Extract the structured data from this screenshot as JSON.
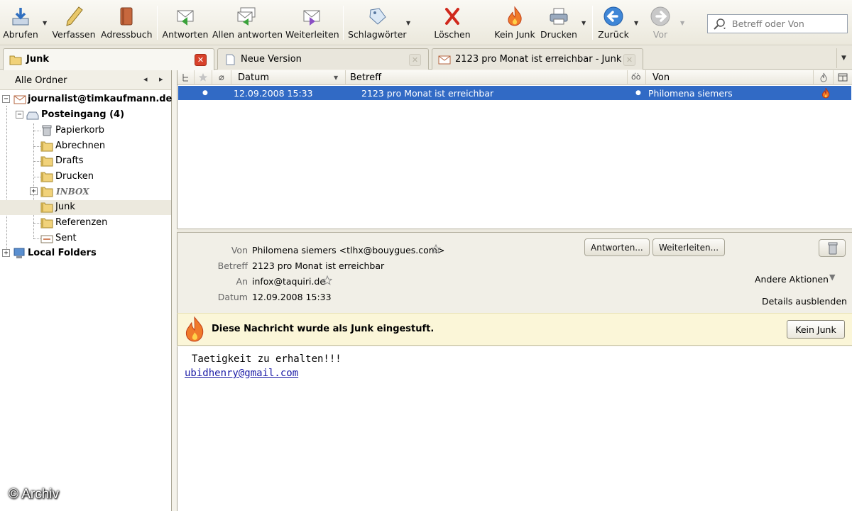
{
  "toolbar": {
    "buttons": [
      {
        "label": "Abrufen",
        "icon": "download-icon"
      },
      {
        "label": "Verfassen",
        "icon": "pencil-icon"
      },
      {
        "label": "Adressbuch",
        "icon": "addressbook-icon"
      },
      {
        "label": "Antworten",
        "icon": "reply-icon"
      },
      {
        "label": "Allen antworten",
        "icon": "reply-all-icon"
      },
      {
        "label": "Weiterleiten",
        "icon": "forward-icon"
      },
      {
        "label": "Schlagwörter",
        "icon": "tag-icon"
      },
      {
        "label": "Löschen",
        "icon": "delete-icon"
      },
      {
        "label": "Kein Junk",
        "icon": "flame-icon"
      },
      {
        "label": "Drucken",
        "icon": "printer-icon"
      },
      {
        "label": "Zurück",
        "icon": "back-arrow-icon"
      },
      {
        "label": "Vor",
        "icon": "forward-arrow-icon"
      }
    ],
    "search_placeholder": "Betreff oder Von"
  },
  "tabs": [
    {
      "label": "Junk",
      "icon": "folder-icon",
      "active": true
    },
    {
      "label": "Neue Version",
      "icon": "document-icon",
      "active": false
    },
    {
      "label": "2123 pro Monat ist erreichbar - Junk",
      "icon": "envelope-icon",
      "active": false
    }
  ],
  "folder_pane": {
    "header": "Alle Ordner",
    "account": "journalist@timkaufmann.de",
    "inbox": "Posteingang (4)",
    "folders": [
      "Papierkorb",
      "Abrechnen",
      "Drafts",
      "Drucken",
      "INBOX",
      "Junk",
      "Referenzen",
      "Sent"
    ],
    "selected": "Junk",
    "local": "Local Folders"
  },
  "thread_pane": {
    "columns": {
      "date": "Datum",
      "subject": "Betreff",
      "from": "Von"
    },
    "message": {
      "date": "12.09.2008 15:33",
      "subject": "2123 pro Monat ist erreichbar",
      "from": "Philomena siemers"
    }
  },
  "message_header": {
    "from_label": "Von",
    "from_value": "Philomena siemers  <tlhx@bouygues.com>",
    "subject_label": "Betreff",
    "subject_value": "2123 pro Monat ist erreichbar",
    "to_label": "An",
    "to_value": "infox@taquiri.de",
    "date_label": "Datum",
    "date_value": "12.09.2008 15:33",
    "reply_button": "Antworten...",
    "forward_button": "Weiterleiten...",
    "more_actions": "Andere Aktionen",
    "hide_details": "Details ausblenden"
  },
  "junk_bar": {
    "text": "Diese Nachricht wurde als Junk eingestuft.",
    "button": "Kein Junk"
  },
  "body": {
    "text": "Taetigkeit zu erhalten!!!",
    "link": "ubidhenry@gmail.com"
  },
  "watermark": "© Archiv",
  "colors": {
    "selection": "#316ac5",
    "junk_bar": "#fbf6d8",
    "flame": "#e8561e"
  }
}
